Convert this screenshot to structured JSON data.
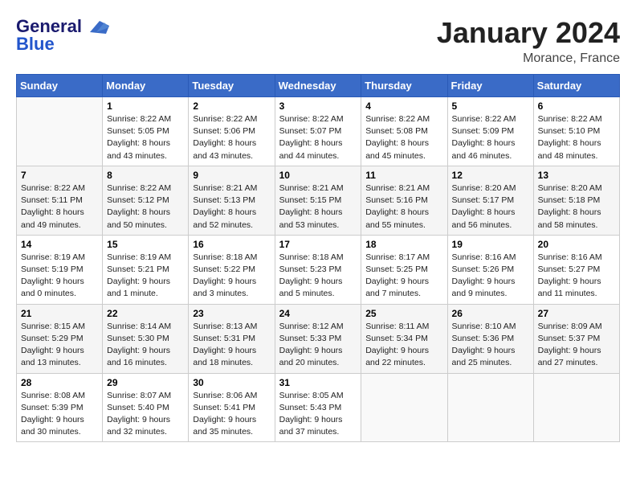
{
  "logo": {
    "general": "General",
    "blue": "Blue"
  },
  "header": {
    "month": "January 2024",
    "location": "Morance, France"
  },
  "weekdays": [
    "Sunday",
    "Monday",
    "Tuesday",
    "Wednesday",
    "Thursday",
    "Friday",
    "Saturday"
  ],
  "weeks": [
    [
      {
        "day": "",
        "sunrise": "",
        "sunset": "",
        "daylight": ""
      },
      {
        "day": "1",
        "sunrise": "Sunrise: 8:22 AM",
        "sunset": "Sunset: 5:05 PM",
        "daylight": "Daylight: 8 hours and 43 minutes."
      },
      {
        "day": "2",
        "sunrise": "Sunrise: 8:22 AM",
        "sunset": "Sunset: 5:06 PM",
        "daylight": "Daylight: 8 hours and 43 minutes."
      },
      {
        "day": "3",
        "sunrise": "Sunrise: 8:22 AM",
        "sunset": "Sunset: 5:07 PM",
        "daylight": "Daylight: 8 hours and 44 minutes."
      },
      {
        "day": "4",
        "sunrise": "Sunrise: 8:22 AM",
        "sunset": "Sunset: 5:08 PM",
        "daylight": "Daylight: 8 hours and 45 minutes."
      },
      {
        "day": "5",
        "sunrise": "Sunrise: 8:22 AM",
        "sunset": "Sunset: 5:09 PM",
        "daylight": "Daylight: 8 hours and 46 minutes."
      },
      {
        "day": "6",
        "sunrise": "Sunrise: 8:22 AM",
        "sunset": "Sunset: 5:10 PM",
        "daylight": "Daylight: 8 hours and 48 minutes."
      }
    ],
    [
      {
        "day": "7",
        "sunrise": "Sunrise: 8:22 AM",
        "sunset": "Sunset: 5:11 PM",
        "daylight": "Daylight: 8 hours and 49 minutes."
      },
      {
        "day": "8",
        "sunrise": "Sunrise: 8:22 AM",
        "sunset": "Sunset: 5:12 PM",
        "daylight": "Daylight: 8 hours and 50 minutes."
      },
      {
        "day": "9",
        "sunrise": "Sunrise: 8:21 AM",
        "sunset": "Sunset: 5:13 PM",
        "daylight": "Daylight: 8 hours and 52 minutes."
      },
      {
        "day": "10",
        "sunrise": "Sunrise: 8:21 AM",
        "sunset": "Sunset: 5:15 PM",
        "daylight": "Daylight: 8 hours and 53 minutes."
      },
      {
        "day": "11",
        "sunrise": "Sunrise: 8:21 AM",
        "sunset": "Sunset: 5:16 PM",
        "daylight": "Daylight: 8 hours and 55 minutes."
      },
      {
        "day": "12",
        "sunrise": "Sunrise: 8:20 AM",
        "sunset": "Sunset: 5:17 PM",
        "daylight": "Daylight: 8 hours and 56 minutes."
      },
      {
        "day": "13",
        "sunrise": "Sunrise: 8:20 AM",
        "sunset": "Sunset: 5:18 PM",
        "daylight": "Daylight: 8 hours and 58 minutes."
      }
    ],
    [
      {
        "day": "14",
        "sunrise": "Sunrise: 8:19 AM",
        "sunset": "Sunset: 5:19 PM",
        "daylight": "Daylight: 9 hours and 0 minutes."
      },
      {
        "day": "15",
        "sunrise": "Sunrise: 8:19 AM",
        "sunset": "Sunset: 5:21 PM",
        "daylight": "Daylight: 9 hours and 1 minute."
      },
      {
        "day": "16",
        "sunrise": "Sunrise: 8:18 AM",
        "sunset": "Sunset: 5:22 PM",
        "daylight": "Daylight: 9 hours and 3 minutes."
      },
      {
        "day": "17",
        "sunrise": "Sunrise: 8:18 AM",
        "sunset": "Sunset: 5:23 PM",
        "daylight": "Daylight: 9 hours and 5 minutes."
      },
      {
        "day": "18",
        "sunrise": "Sunrise: 8:17 AM",
        "sunset": "Sunset: 5:25 PM",
        "daylight": "Daylight: 9 hours and 7 minutes."
      },
      {
        "day": "19",
        "sunrise": "Sunrise: 8:16 AM",
        "sunset": "Sunset: 5:26 PM",
        "daylight": "Daylight: 9 hours and 9 minutes."
      },
      {
        "day": "20",
        "sunrise": "Sunrise: 8:16 AM",
        "sunset": "Sunset: 5:27 PM",
        "daylight": "Daylight: 9 hours and 11 minutes."
      }
    ],
    [
      {
        "day": "21",
        "sunrise": "Sunrise: 8:15 AM",
        "sunset": "Sunset: 5:29 PM",
        "daylight": "Daylight: 9 hours and 13 minutes."
      },
      {
        "day": "22",
        "sunrise": "Sunrise: 8:14 AM",
        "sunset": "Sunset: 5:30 PM",
        "daylight": "Daylight: 9 hours and 16 minutes."
      },
      {
        "day": "23",
        "sunrise": "Sunrise: 8:13 AM",
        "sunset": "Sunset: 5:31 PM",
        "daylight": "Daylight: 9 hours and 18 minutes."
      },
      {
        "day": "24",
        "sunrise": "Sunrise: 8:12 AM",
        "sunset": "Sunset: 5:33 PM",
        "daylight": "Daylight: 9 hours and 20 minutes."
      },
      {
        "day": "25",
        "sunrise": "Sunrise: 8:11 AM",
        "sunset": "Sunset: 5:34 PM",
        "daylight": "Daylight: 9 hours and 22 minutes."
      },
      {
        "day": "26",
        "sunrise": "Sunrise: 8:10 AM",
        "sunset": "Sunset: 5:36 PM",
        "daylight": "Daylight: 9 hours and 25 minutes."
      },
      {
        "day": "27",
        "sunrise": "Sunrise: 8:09 AM",
        "sunset": "Sunset: 5:37 PM",
        "daylight": "Daylight: 9 hours and 27 minutes."
      }
    ],
    [
      {
        "day": "28",
        "sunrise": "Sunrise: 8:08 AM",
        "sunset": "Sunset: 5:39 PM",
        "daylight": "Daylight: 9 hours and 30 minutes."
      },
      {
        "day": "29",
        "sunrise": "Sunrise: 8:07 AM",
        "sunset": "Sunset: 5:40 PM",
        "daylight": "Daylight: 9 hours and 32 minutes."
      },
      {
        "day": "30",
        "sunrise": "Sunrise: 8:06 AM",
        "sunset": "Sunset: 5:41 PM",
        "daylight": "Daylight: 9 hours and 35 minutes."
      },
      {
        "day": "31",
        "sunrise": "Sunrise: 8:05 AM",
        "sunset": "Sunset: 5:43 PM",
        "daylight": "Daylight: 9 hours and 37 minutes."
      },
      {
        "day": "",
        "sunrise": "",
        "sunset": "",
        "daylight": ""
      },
      {
        "day": "",
        "sunrise": "",
        "sunset": "",
        "daylight": ""
      },
      {
        "day": "",
        "sunrise": "",
        "sunset": "",
        "daylight": ""
      }
    ]
  ]
}
